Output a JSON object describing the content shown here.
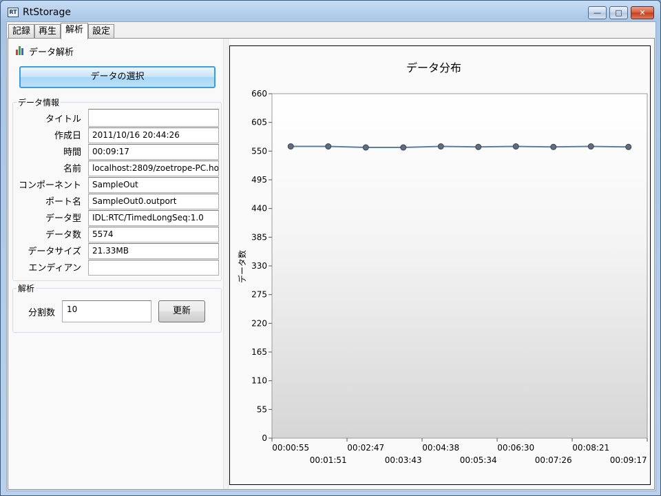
{
  "window": {
    "title": "RtStorage",
    "icon_label": "RT"
  },
  "tabs": [
    {
      "label": "記録",
      "active": false
    },
    {
      "label": "再生",
      "active": false
    },
    {
      "label": "解析",
      "active": true
    },
    {
      "label": "設定",
      "active": false
    }
  ],
  "analysis": {
    "section_title": "データ解析",
    "select_button": "データの選択",
    "info_group_label": "データ情報",
    "fields": [
      {
        "label": "タイトル",
        "value": ""
      },
      {
        "label": "作成日",
        "value": "2011/10/16 20:44:26"
      },
      {
        "label": "時間",
        "value": "00:09:17"
      },
      {
        "label": "名前",
        "value": "localhost:2809/zoetrope-PC.ho"
      },
      {
        "label": "コンポーネント",
        "value": "SampleOut"
      },
      {
        "label": "ポート名",
        "value": "SampleOut0.outport"
      },
      {
        "label": "データ型",
        "value": "IDL:RTC/TimedLongSeq:1.0"
      },
      {
        "label": "データ数",
        "value": "5574"
      },
      {
        "label": "データサイズ",
        "value": "21.33MB"
      },
      {
        "label": "エンディアン",
        "value": ""
      }
    ],
    "analysis_group_label": "解析",
    "divisions_label": "分割数",
    "divisions_value": "10",
    "update_button": "更新"
  },
  "colors": {
    "series": "#5b7f9e",
    "marker": "#5f6d7c",
    "selected_border": "#3d9be3"
  },
  "chart_data": {
    "type": "line",
    "title": "データ分布",
    "xlabel": "",
    "ylabel": "データ数",
    "x": [
      "00:00:55",
      "00:01:51",
      "00:02:47",
      "00:03:43",
      "00:04:38",
      "00:05:34",
      "00:06:30",
      "00:07:26",
      "00:08:21",
      "00:09:17"
    ],
    "series": [
      {
        "values": [
          559,
          559,
          557,
          557,
          559,
          558,
          559,
          558,
          559,
          558
        ]
      }
    ],
    "ylim": [
      0,
      660
    ],
    "yticks": [
      0,
      55,
      110,
      165,
      220,
      275,
      330,
      385,
      440,
      495,
      550,
      605,
      660
    ],
    "grid": false,
    "legend": "none"
  }
}
